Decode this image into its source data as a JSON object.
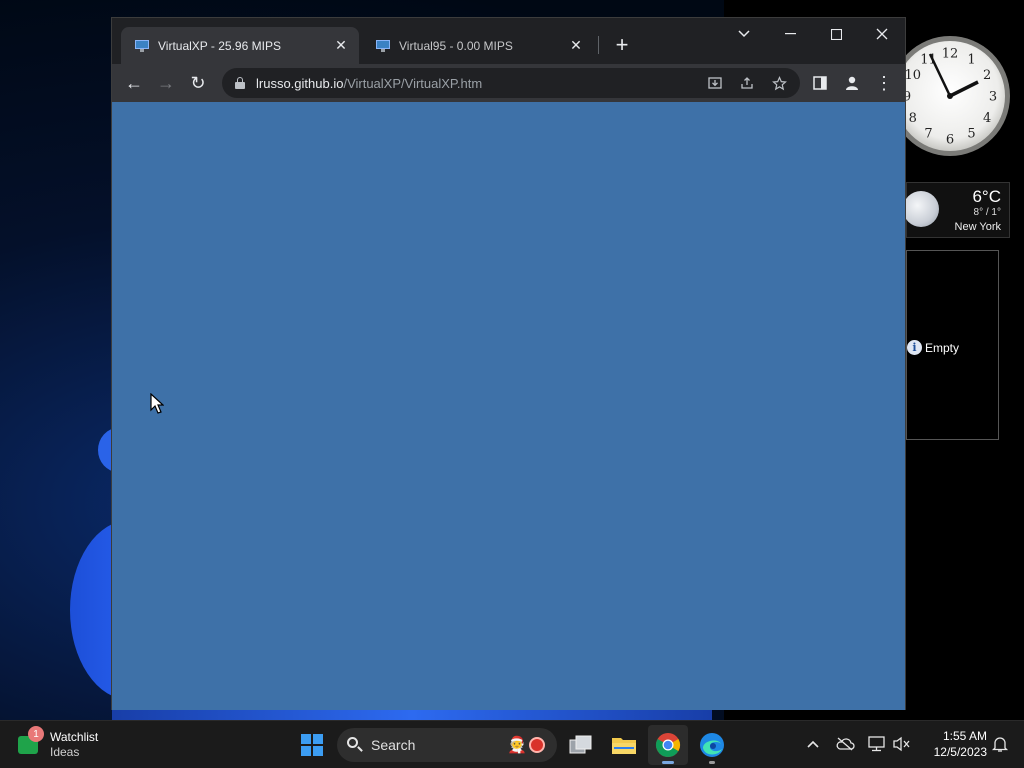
{
  "browser": {
    "tabs": [
      {
        "title": "VirtualXP - 25.96 MIPS",
        "active": true
      },
      {
        "title": "Virtual95 - 0.00 MIPS",
        "active": false
      }
    ],
    "new_tab": "+",
    "tab_close": "✕",
    "controls": {
      "tab_search": "⌄",
      "minimize": "—",
      "maximize": "☐",
      "close": "✕"
    },
    "toolbar": {
      "back": "←",
      "forward": "→",
      "reload": "↻",
      "menu": "⋮"
    },
    "address": {
      "host": "lrusso.github.io",
      "path": "/VirtualXP/VirtualXP.htm"
    },
    "omnibox_icons": [
      "install-icon",
      "share-icon",
      "star-icon"
    ],
    "viewport_color": "#3e71a8"
  },
  "desktop_gadgets": {
    "clock_numbers": [
      "12",
      "1",
      "2",
      "3",
      "4",
      "5",
      "6",
      "7",
      "8",
      "9",
      "10",
      "11"
    ],
    "weather": {
      "temp": "6°C",
      "range": "8° / 1°",
      "city": "New York"
    },
    "notes_status": "Empty"
  },
  "taskbar": {
    "widgets": {
      "badge": "1",
      "title": "Watchlist",
      "subtitle": "Ideas"
    },
    "search_placeholder": "Search",
    "pinned": [
      "start",
      "task-view",
      "file-explorer",
      "chrome",
      "edge"
    ],
    "tray": {
      "time": "1:55 AM",
      "date": "12/5/2023"
    }
  }
}
